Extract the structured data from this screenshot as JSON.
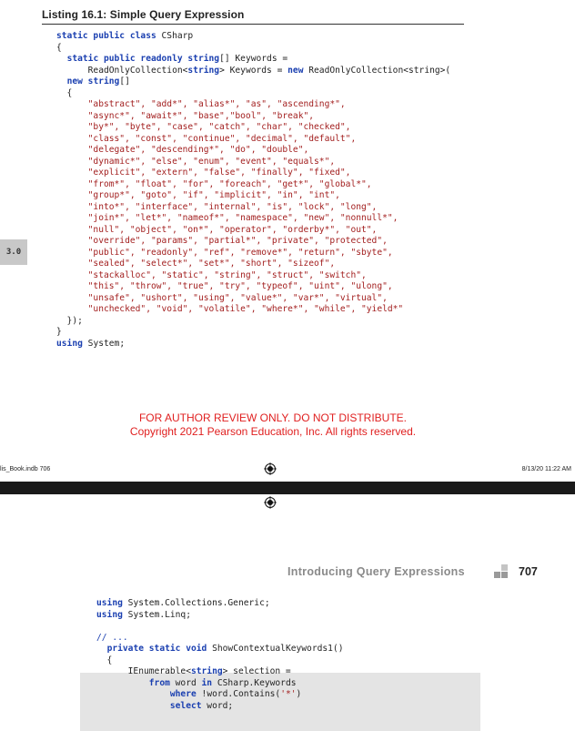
{
  "listing": {
    "title": "Listing 16.1: Simple Query Expression"
  },
  "side_tab": "3.0",
  "code_top": [
    [
      {
        "t": "static public class",
        "c": "kw"
      },
      {
        "t": " CSharp"
      }
    ],
    [
      {
        "t": "{"
      }
    ],
    [
      {
        "t": "  "
      },
      {
        "t": "static public readonly string",
        "c": "kw"
      },
      {
        "t": "[] Keywords ="
      }
    ],
    [
      {
        "t": "      ReadOnlyCollection<"
      },
      {
        "t": "string",
        "c": "kw"
      },
      {
        "t": "> Keywords = "
      },
      {
        "t": "new",
        "c": "kw"
      },
      {
        "t": " ReadOnlyCollection<string>("
      }
    ],
    [
      {
        "t": "  "
      },
      {
        "t": "new string",
        "c": "kw"
      },
      {
        "t": "[]"
      }
    ],
    [
      {
        "t": "  {"
      }
    ],
    [
      {
        "t": "      "
      },
      {
        "t": "\"abstract\", \"add*\", \"alias*\", \"as\", \"ascending*\",",
        "c": "str"
      }
    ],
    [
      {
        "t": "      "
      },
      {
        "t": "\"async*\", \"await*\", \"base\",\"bool\", \"break\",",
        "c": "str"
      }
    ],
    [
      {
        "t": "      "
      },
      {
        "t": "\"by*\", \"byte\", \"case\", \"catch\", \"char\", \"checked\",",
        "c": "str"
      }
    ],
    [
      {
        "t": "      "
      },
      {
        "t": "\"class\", \"const\", \"continue\", \"decimal\", \"default\",",
        "c": "str"
      }
    ],
    [
      {
        "t": "      "
      },
      {
        "t": "\"delegate\", \"descending*\", \"do\", \"double\",",
        "c": "str"
      }
    ],
    [
      {
        "t": "      "
      },
      {
        "t": "\"dynamic*\", \"else\", \"enum\", \"event\", \"equals*\",",
        "c": "str"
      }
    ],
    [
      {
        "t": "      "
      },
      {
        "t": "\"explicit\", \"extern\", \"false\", \"finally\", \"fixed\",",
        "c": "str"
      }
    ],
    [
      {
        "t": "      "
      },
      {
        "t": "\"from*\", \"float\", \"for\", \"foreach\", \"get*\", \"global*\",",
        "c": "str"
      }
    ],
    [
      {
        "t": "      "
      },
      {
        "t": "\"group*\", \"goto\", \"if\", \"implicit\", \"in\", \"int\",",
        "c": "str"
      }
    ],
    [
      {
        "t": "      "
      },
      {
        "t": "\"into*\", \"interface\", \"internal\", \"is\", \"lock\", \"long\",",
        "c": "str"
      }
    ],
    [
      {
        "t": "      "
      },
      {
        "t": "\"join*\", \"let*\", \"nameof*\", \"namespace\", \"new\", \"nonnull*\",",
        "c": "str"
      }
    ],
    [
      {
        "t": "      "
      },
      {
        "t": "\"null\", \"object\", \"on*\", \"operator\", \"orderby*\", \"out\",",
        "c": "str"
      }
    ],
    [
      {
        "t": "      "
      },
      {
        "t": "\"override\", \"params\", \"partial*\", \"private\", \"protected\",",
        "c": "str"
      }
    ],
    [
      {
        "t": "      "
      },
      {
        "t": "\"public\", \"readonly\", \"ref\", \"remove*\", \"return\", \"sbyte\",",
        "c": "str"
      }
    ],
    [
      {
        "t": "      "
      },
      {
        "t": "\"sealed\", \"select*\", \"set*\", \"short\", \"sizeof\",",
        "c": "str"
      }
    ],
    [
      {
        "t": "      "
      },
      {
        "t": "\"stackalloc\", \"static\", \"string\", \"struct\", \"switch\",",
        "c": "str"
      }
    ],
    [
      {
        "t": "      "
      },
      {
        "t": "\"this\", \"throw\", \"true\", \"try\", \"typeof\", \"uint\", \"ulong\",",
        "c": "str"
      }
    ],
    [
      {
        "t": "      "
      },
      {
        "t": "\"unsafe\", \"ushort\", \"using\", \"value*\", \"var*\", \"virtual\",",
        "c": "str"
      }
    ],
    [
      {
        "t": "      "
      },
      {
        "t": "\"unchecked\", \"void\", \"volatile\", \"where*\", \"while\", \"yield*\"",
        "c": "str"
      }
    ],
    [
      {
        "t": "  });"
      }
    ],
    [
      {
        "t": "}"
      }
    ],
    [
      {
        "t": "using",
        "c": "kw"
      },
      {
        "t": " System;"
      }
    ]
  ],
  "notice": {
    "line1": "FOR AUTHOR REVIEW ONLY. DO NOT DISTRIBUTE.",
    "line2": "Copyright 2021 Pearson Education, Inc. All rights reserved."
  },
  "slug": {
    "left": "lis_Book.indb   706",
    "right": "8/13/20   11:22 AM"
  },
  "header": {
    "title": "Introducing Query Expressions",
    "page_number": "707"
  },
  "code_bottom": [
    [
      {
        "t": "using",
        "c": "kw"
      },
      {
        "t": " System.Collections.Generic;"
      }
    ],
    [
      {
        "t": "using",
        "c": "kw"
      },
      {
        "t": " System.Linq;"
      }
    ],
    [
      {
        "t": ""
      }
    ],
    [
      {
        "t": "// ...",
        "c": "cm"
      }
    ],
    [
      {
        "t": "  "
      },
      {
        "t": "private static void",
        "c": "kw"
      },
      {
        "t": " ShowContextualKeywords1()"
      }
    ],
    [
      {
        "t": "  {"
      }
    ],
    [
      {
        "t": "      IEnumerable<"
      },
      {
        "t": "string",
        "c": "kw"
      },
      {
        "t": "> selection ="
      }
    ],
    [
      {
        "t": "          "
      },
      {
        "t": "from",
        "c": "kw"
      },
      {
        "t": " word "
      },
      {
        "t": "in",
        "c": "kw"
      },
      {
        "t": " CSharp.Keywords"
      }
    ],
    [
      {
        "t": "              "
      },
      {
        "t": "where",
        "c": "kw"
      },
      {
        "t": " !word.Contains("
      },
      {
        "t": "'*'",
        "c": "str"
      },
      {
        "t": ")"
      }
    ],
    [
      {
        "t": "              "
      },
      {
        "t": "select",
        "c": "kw"
      },
      {
        "t": " word;"
      }
    ]
  ]
}
